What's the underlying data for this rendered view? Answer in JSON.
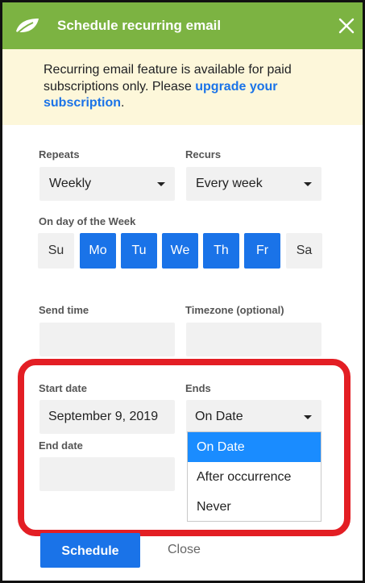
{
  "header": {
    "title": "Schedule recurring email",
    "close_icon": "close-icon",
    "logo_icon": "leaf-logo-icon",
    "background_color": "#7cb342"
  },
  "notice": {
    "text_before": "Recurring email feature is available for paid subscriptions only. Please ",
    "link_text": "upgrade your subscription",
    "text_after": ".",
    "background_color": "#fdf7da",
    "link_color": "#1a73e8"
  },
  "repeats": {
    "label": "Repeats",
    "value": "Weekly"
  },
  "recurs": {
    "label": "Recurs",
    "value": "Every week"
  },
  "days": {
    "label": "On day of the Week",
    "items": [
      {
        "label": "Su",
        "selected": false
      },
      {
        "label": "Mo",
        "selected": true
      },
      {
        "label": "Tu",
        "selected": true
      },
      {
        "label": "We",
        "selected": true
      },
      {
        "label": "Th",
        "selected": true
      },
      {
        "label": "Fr",
        "selected": true
      },
      {
        "label": "Sa",
        "selected": false
      }
    ]
  },
  "send_time": {
    "label": "Send time",
    "value": ""
  },
  "timezone": {
    "label": "Timezone (optional)",
    "value": ""
  },
  "start_date": {
    "label": "Start date",
    "value": "September 9, 2019"
  },
  "ends": {
    "label": "Ends",
    "value": "On Date",
    "options": [
      "On Date",
      "After occurrence",
      "Never"
    ]
  },
  "end_date": {
    "label": "End date",
    "value": ""
  },
  "actions": {
    "schedule_label": "Schedule",
    "close_label": "Close"
  },
  "colors": {
    "accent": "#1a73e8",
    "highlight": "#e31e24",
    "option_selected": "#1a8cff"
  }
}
